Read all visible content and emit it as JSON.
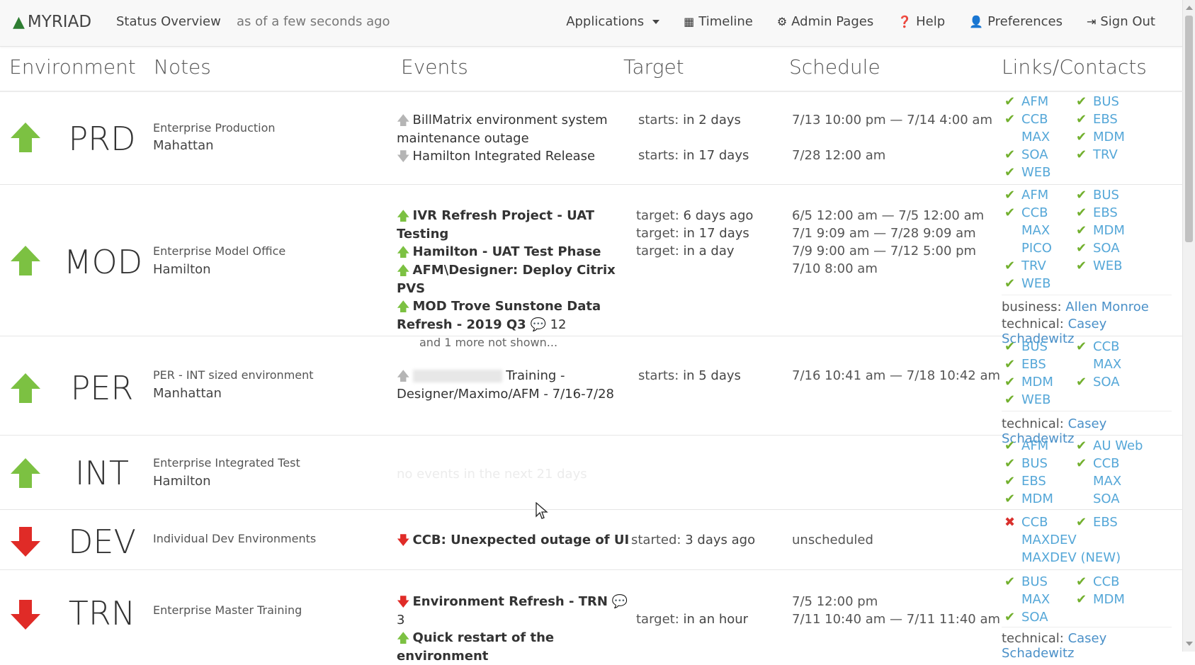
{
  "navbar": {
    "brand": "MYRIAD",
    "title": "Status Overview",
    "as_of": "as of a few seconds ago",
    "applications": "Applications",
    "timeline": "Timeline",
    "admin": "Admin Pages",
    "help": "Help",
    "preferences": "Preferences",
    "sign_out": "Sign Out"
  },
  "columns": {
    "environment": "Environment",
    "notes": "Notes",
    "events": "Events",
    "target": "Target",
    "schedule": "Schedule",
    "links": "Links/Contacts"
  },
  "colors": {
    "up": "#7cc142",
    "down": "#e02b27",
    "link": "#55a7d8",
    "check": "#72b02e"
  },
  "rows": [
    {
      "env": "PRD",
      "status": "up",
      "desc": "Enterprise Production",
      "location": "Mahattan",
      "events": [
        {
          "l1": "BillMatrix environment system",
          "l2": "maintenance outage"
        },
        {
          "l1": "Hamilton Integrated Release"
        }
      ],
      "targets": [
        {
          "label": "starts:",
          "value": "in 2 days"
        },
        {
          "label": "starts:",
          "value": "in 17 days"
        }
      ],
      "schedule": [
        "7/13 10:00 pm — 7/14 4:00 am",
        "7/28 12:00 am"
      ],
      "links": [
        "AFM",
        "BUS",
        "CCB",
        "EBS",
        "MAX",
        "MDM",
        "SOA",
        "TRV",
        "WEB"
      ]
    },
    {
      "env": "MOD",
      "status": "up",
      "desc": "Enterprise Model Office",
      "location": "Hamilton",
      "events": [
        {
          "l1": "IVR Refresh Project - UAT Testing"
        },
        {
          "l1": "Hamilton - UAT Test Phase"
        },
        {
          "l1": "AFM\\Designer: Deploy Citrix PVS"
        },
        {
          "l1": "MOD Trove Sunstone Data",
          "l2": "Refresh - 2019 Q3",
          "comments": "12"
        }
      ],
      "more": "and 1 more not shown...",
      "targets": [
        {
          "label": "target:",
          "value": "6 days ago"
        },
        {
          "label": "target:",
          "value": "in 17 days"
        },
        {
          "label": "target:",
          "value": "in a day"
        }
      ],
      "schedule": [
        "6/5 12:00 am — 7/5 12:00 am",
        "7/1 9:09 am — 7/28 9:09 am",
        "7/9 9:00 am — 7/12 5:00 pm",
        "7/10 8:00 am"
      ],
      "links": [
        "AFM",
        "BUS",
        "CCB",
        "EBS",
        "MAX",
        "MDM",
        "PICO",
        "SOA",
        "TRV",
        "WEB",
        "WEB"
      ],
      "business_label": "business:",
      "business": "Allen Monroe",
      "technical_label": "technical:",
      "technical": "Casey Schadewitz"
    },
    {
      "env": "PER",
      "status": "up",
      "desc": "PER - INT sized environment",
      "location": "Manhattan",
      "events": [
        {
          "l1": "Training -",
          "l2": "Designer/Maximo/AFM - 7/16-7/28"
        }
      ],
      "targets": [
        {
          "label": "starts:",
          "value": "in 5 days"
        }
      ],
      "schedule": [
        "7/16 10:41 am — 7/18 10:42 am"
      ],
      "links": [
        "BUS",
        "CCB",
        "EBS",
        "MAX",
        "MDM",
        "SOA",
        "WEB"
      ],
      "technical_label": "technical:",
      "technical": "Casey Schadewitz"
    },
    {
      "env": "INT",
      "status": "up",
      "desc": "Enterprise Integrated Test",
      "location": "Hamilton",
      "no_events": "no events in the next 21 days",
      "links": [
        "AFM",
        "AU Web",
        "BUS",
        "CCB",
        "EBS",
        "MAX",
        "MDM",
        "SOA"
      ]
    },
    {
      "env": "DEV",
      "status": "down",
      "desc": "Individual Dev Environments",
      "events": [
        {
          "l1": "CCB: Unexpected outage of UI"
        }
      ],
      "targets": [
        {
          "label": "started:",
          "value": "3 days ago"
        }
      ],
      "schedule": [
        "unscheduled"
      ],
      "links": [
        "CCB",
        "EBS",
        "MAXDEV",
        "MAXDEV (NEW)"
      ]
    },
    {
      "env": "TRN",
      "status": "down",
      "desc": "Enterprise Master Training",
      "events": [
        {
          "l1": "Environment Refresh - TRN",
          "comments": "3"
        },
        {
          "l1": "Quick restart of the environment"
        }
      ],
      "targets": [
        {
          "label": "target:",
          "value": "in an hour"
        }
      ],
      "schedule": [
        "7/5 12:00 pm",
        "7/11 10:40 am — 7/11 11:40 am"
      ],
      "links": [
        "BUS",
        "CCB",
        "MAX",
        "MDM",
        "SOA"
      ],
      "technical_label": "technical:",
      "technical": "Casey Schadewitz"
    }
  ]
}
